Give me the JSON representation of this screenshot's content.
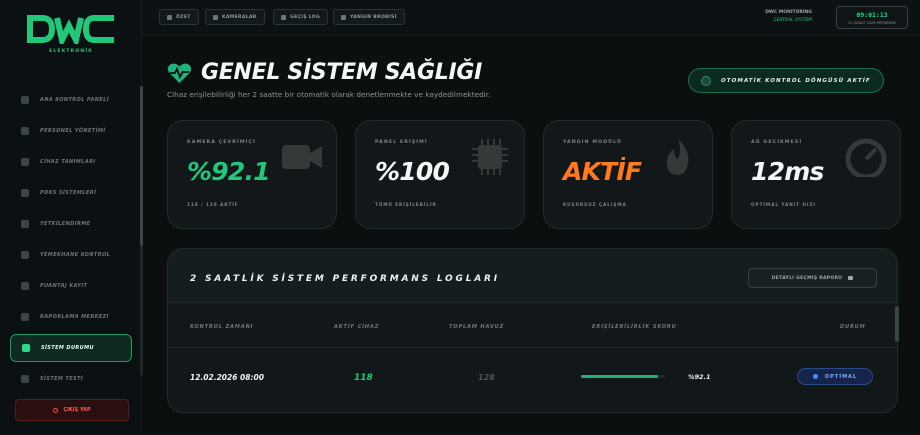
{
  "brand": {
    "logo": "DWC",
    "sub": "ELEKTRONİK",
    "accent": "#22c87a"
  },
  "sidebar": {
    "items": [
      {
        "label": "ANA KONTROL PANELİ",
        "icon": "dashboard-icon"
      },
      {
        "label": "PERSONEL YÖNETİMİ",
        "icon": "users-icon"
      },
      {
        "label": "CİHAZ TANIMLARI",
        "icon": "device-icon"
      },
      {
        "label": "PDKS SİSTEMLERİ",
        "icon": "clock-icon"
      },
      {
        "label": "YETKİLENDİRME",
        "icon": "shield-icon"
      },
      {
        "label": "YEMEKHANE KONTROL",
        "icon": "cutlery-icon"
      },
      {
        "label": "PUANTAJ KAYIT",
        "icon": "calendar-icon"
      },
      {
        "label": "RAPORLAMA MERKEZİ",
        "icon": "chart-icon"
      },
      {
        "label": "SİSTEM DURUMU",
        "icon": "heart-icon",
        "active": true
      },
      {
        "label": "SİSTEM TESTİ",
        "icon": "test-icon"
      }
    ],
    "logout": "ÇIKIŞ YAP"
  },
  "topbar": {
    "buttons": [
      "ÖZET",
      "KAMERALAR",
      "GEÇİŞ LOG",
      "YANGIN BROBİSİ"
    ],
    "monitor_title": "DWC MONITORING",
    "monitor_sub": "CENTRAL SYSTEM",
    "clock_time": "09:01:13",
    "clock_date": "12 ŞUBAT 2026 PERŞEMBE"
  },
  "header": {
    "title": "GENEL SİSTEM SAĞLIĞI",
    "subtitle": "Cihaz erişilebilirliği her 2 saatte bir otomatik olarak denetlenmekte ve kaydedilmektedir.",
    "auto_label": "OTOMATİK KONTROL DÖNGÜSÜ AKTİF"
  },
  "cards": [
    {
      "label": "KAMERA ÇEVRİMİÇİ",
      "value": "%92.1",
      "foot": "118 / 128 AKTİF",
      "color": "#22c87a",
      "icon": "camera-icon"
    },
    {
      "label": "PANEL ERİŞİMİ",
      "value": "%100",
      "foot": "TÜMÜ ERİŞİLEBİLİR",
      "color": "#f4f7f7",
      "icon": "chip-icon"
    },
    {
      "label": "YANGIN MODÜLÜ",
      "value": "AKTİF",
      "foot": "KUSURSUZ ÇALIŞMA",
      "color": "#ff7a1f",
      "icon": "fire-icon"
    },
    {
      "label": "AĞ GECİKMESİ",
      "value": "12ms",
      "foot": "OPTİMAL YANIT HIZI",
      "color": "#f4f7f7",
      "icon": "gauge-icon"
    }
  ],
  "logs": {
    "title": "2 SAATLİK SİSTEM PERFORMANS LOGLARI",
    "report_button": "DETAYLI GEÇMİŞ RAPORU",
    "columns": [
      "KONTROL ZAMANI",
      "AKTİF CİHAZ",
      "TOPLAM HAVUZ",
      "ERİŞİLEBİLİRLİK SKORU",
      "DURUM"
    ],
    "rows": [
      {
        "time": "12.02.2026 08:00",
        "active": "118",
        "total": "128",
        "score": "%92.1",
        "score_fraction": 0.921,
        "status": "OPTİMAL"
      }
    ]
  }
}
